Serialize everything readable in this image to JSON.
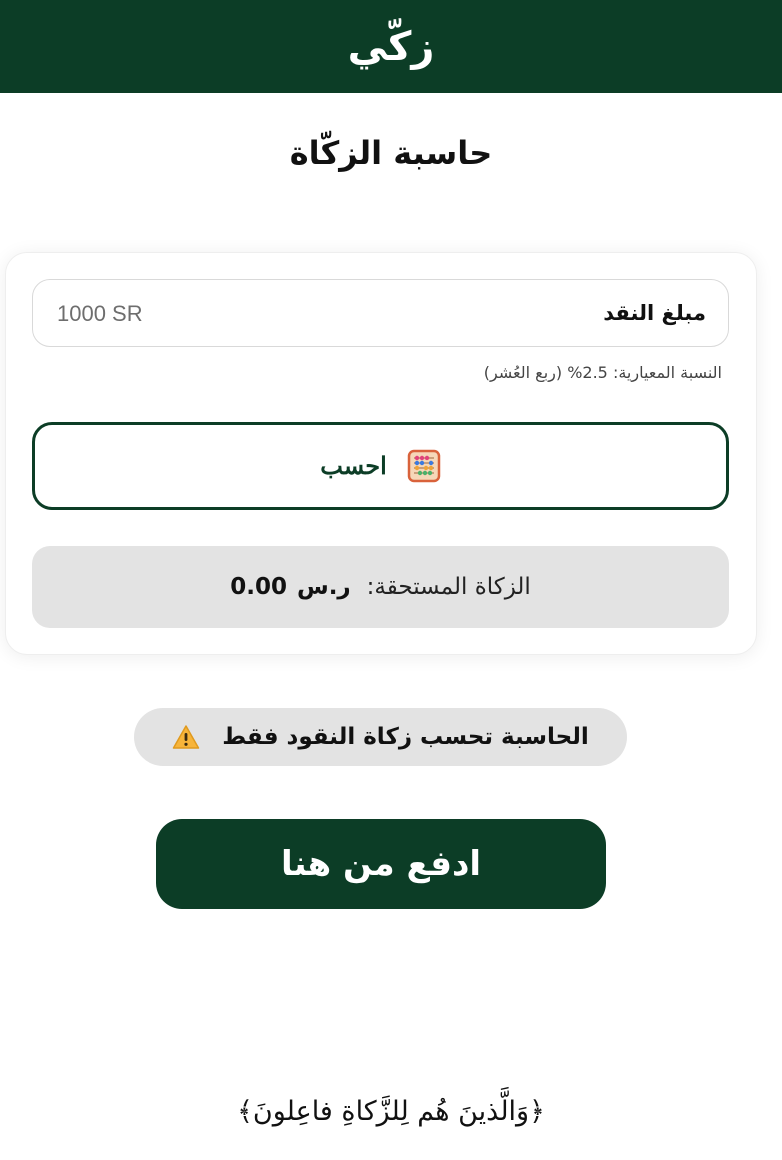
{
  "header": {
    "logo_text": "زكّي"
  },
  "page": {
    "title": "حاسبة الزكّاة"
  },
  "calculator": {
    "amount_label": "مبلغ النقد",
    "amount_placeholder": "1000 SR",
    "amount_value": "",
    "rate_note": "النسبة المعيارية: 2.5% (ربع العُشر)",
    "calculate_label": "احسب",
    "calculate_icon": "abacus-icon",
    "result_label": "الزكاة المستحقة:",
    "result_amount": "0.00",
    "result_currency": "ر.س"
  },
  "notice": {
    "text": "الحاسبة تحسب زكاة النقود فقط",
    "icon": "warning-icon"
  },
  "pay": {
    "label": "ادفع من هنا"
  },
  "footer": {
    "verse": "﴿وَالَّذينَ هُم لِلزَّكاةِ فاعِلونَ﴾"
  },
  "colors": {
    "brand_green": "#0c3d26",
    "panel_gray": "#e3e3e3",
    "background": "#ffffff"
  }
}
